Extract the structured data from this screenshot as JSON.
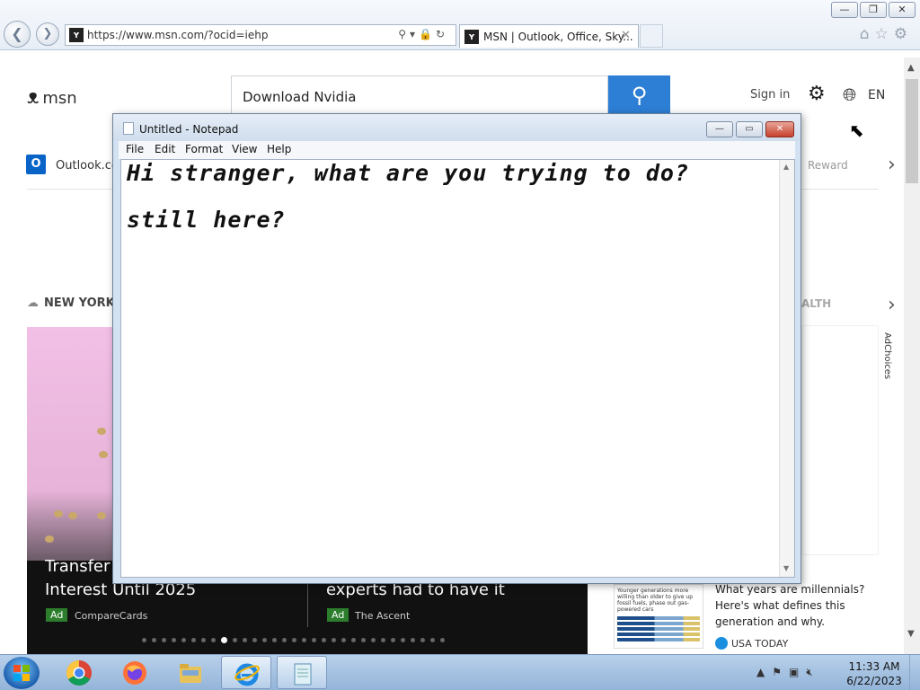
{
  "browser": {
    "url": "https://www.msn.com/?ocid=iehp",
    "tab_title": "MSN | Outlook, Office, Sky...",
    "window_controls": {
      "minimize": "—",
      "restore": "❐",
      "close": "✕"
    },
    "nav_icons": {
      "back": "back-icon",
      "forward": "forward-icon"
    }
  },
  "msn": {
    "logo_text": "msn",
    "search_value": "Download Nvidia",
    "signin": "Sign in",
    "lang": "EN",
    "quicklinks": {
      "outlook": "Outlook.co",
      "rewards": "Reward"
    },
    "weather_location": "NEW YORK",
    "health_label": "ALTH",
    "carousel": {
      "card1_title_line1": "Transfer",
      "card1_title_line2": "Interest Until 2025",
      "card1_ad": "Ad",
      "card1_source": "CompareCards",
      "card2_title": "experts had to have it",
      "card2_ad": "Ad",
      "card2_source": "The Ascent",
      "dot_count": 31,
      "active_dot": 8
    },
    "adchoices": "AdChoices",
    "news_card": {
      "thumb_caption": "Younger generations more willing than older to give up fossil fuels, phase out gas-powered cars",
      "headline": "What years are millennials? Here's what defines this generation and why.",
      "source": "USA TODAY"
    }
  },
  "notepad": {
    "title": "Untitled - Notepad",
    "menu": {
      "file": "File",
      "edit": "Edit",
      "format": "Format",
      "view": "View",
      "help": "Help"
    },
    "lines": [
      "Hi stranger, what are you trying to do?",
      "still here?"
    ]
  },
  "taskbar": {
    "time": "11:33 AM",
    "date": "6/22/2023"
  },
  "colors": {
    "msn_search_button": "#2c7fd5",
    "taskbar": "#a9c4e3",
    "ad_badge": "#2c7d2c"
  }
}
